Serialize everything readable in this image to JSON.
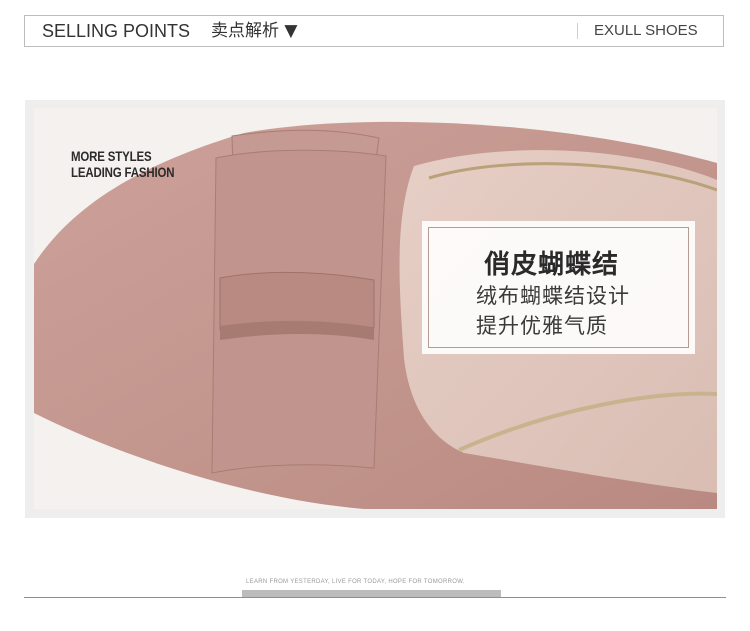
{
  "header": {
    "title_en": "SELLING POINTS",
    "title_cn": "卖点解析 ▼",
    "brand": "EXULL SHOES"
  },
  "photo": {
    "tagline_line1": "MORE STYLES",
    "tagline_line2": "LEADING FASHION",
    "subject": "pink suede pointed-toe pump with bow",
    "colors": {
      "suede": "#c2978f",
      "lining": "#e2c8bf",
      "background": "#f4f1ef"
    }
  },
  "feature_card": {
    "title": "俏皮蝴蝶结",
    "line1": "绒布蝴蝶结设计",
    "line2": "提升优雅气质"
  },
  "footer": {
    "slogan": "LEARN FROM YESTERDAY, LIVE FOR TODAY, HOPE FOR TOMORROW."
  }
}
